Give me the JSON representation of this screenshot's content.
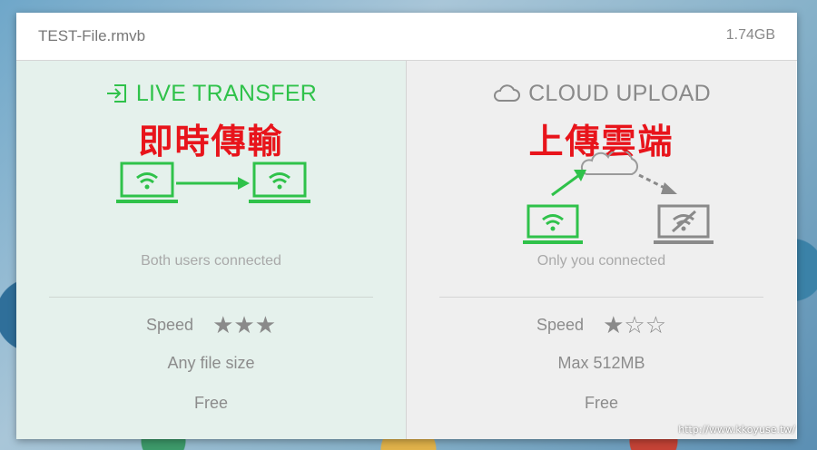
{
  "header": {
    "filename": "TEST-File.rmvb",
    "filesize": "1.74GB"
  },
  "live": {
    "title": "LIVE TRANSFER",
    "icon": "enter-arrow-icon",
    "overlay": "即時傳輸",
    "status": "Both users connected",
    "speed_label": "Speed",
    "speed_stars": 3,
    "speed_max": 5,
    "feature": "Any file size",
    "price": "Free",
    "accent": "#2fc24a"
  },
  "cloud": {
    "title": "CLOUD UPLOAD",
    "icon": "cloud-icon",
    "overlay": "上傳雲端",
    "status": "Only you connected",
    "speed_label": "Speed",
    "speed_stars": 1,
    "speed_max": 3,
    "feature": "Max 512MB",
    "price": "Free",
    "accent": "#8a8a8a"
  },
  "overlay_color": "#e8141b",
  "watermark": "http://www.kkoyuse.tw/"
}
